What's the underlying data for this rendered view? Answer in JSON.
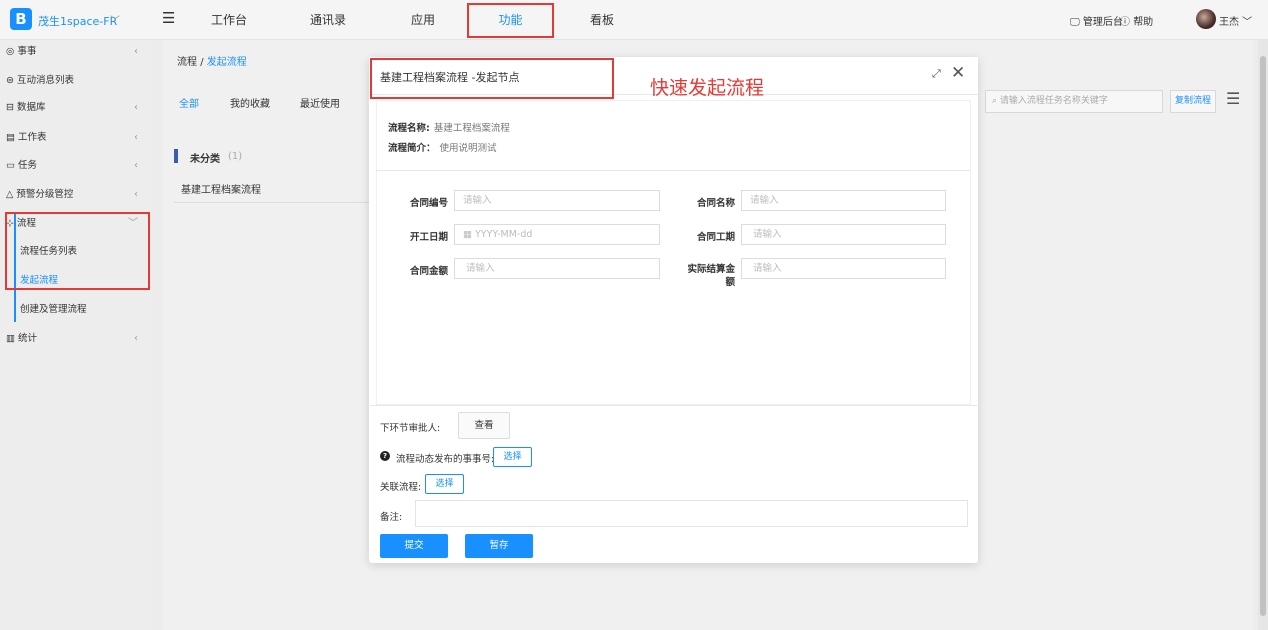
{
  "topbar": {
    "logo_letter": "B",
    "org_name": "茂生1space-FR",
    "nav": [
      "工作台",
      "通讯录",
      "应用",
      "功能",
      "看板"
    ],
    "admin": "管理后台",
    "help": "帮助",
    "user": "王杰"
  },
  "sidebar": {
    "items": [
      {
        "label": "事事"
      },
      {
        "label": "互动消息列表"
      },
      {
        "label": "数据库"
      },
      {
        "label": "工作表"
      },
      {
        "label": "任务"
      },
      {
        "label": "预警分级管控"
      },
      {
        "label": "流程"
      },
      {
        "label": "流程任务列表"
      },
      {
        "label": "发起流程"
      },
      {
        "label": "创建及管理流程"
      },
      {
        "label": "统计"
      }
    ]
  },
  "main": {
    "breadcrumb": {
      "root": "流程",
      "sep": "/",
      "current": "发起流程"
    },
    "tabs": [
      "全部",
      "我的收藏",
      "最近使用"
    ],
    "search_placeholder": "请输入流程任务名称关键字",
    "copy_button": "复制流程",
    "category": {
      "name": "未分类",
      "count": "(1)"
    },
    "list": [
      "基建工程档案流程"
    ]
  },
  "modal": {
    "title": "基建工程档案流程 -发起节点",
    "annotation": "快速发起流程",
    "info": {
      "name_key": "流程名称:",
      "name_value": "基建工程档案流程",
      "desc_key": "流程简介：",
      "desc_value": "使用说明测试"
    },
    "fields": [
      {
        "label": "合同编号",
        "placeholder": "请输入"
      },
      {
        "label": "合同名称",
        "placeholder": "请输入"
      },
      {
        "label": "开工日期",
        "placeholder": "YYYY-MM-dd"
      },
      {
        "label": "合同工期",
        "placeholder": "请输入"
      },
      {
        "label": "合同金额",
        "placeholder": "请输入"
      },
      {
        "label_line1": "实际结算金",
        "label_line2": "额",
        "placeholder": "请输入"
      }
    ],
    "next_approver_label": "下环节审批人:",
    "view_button": "查看",
    "dynamic_label": "流程动态发布的事事号:",
    "select_button": "选择",
    "related_label": "关联流程:",
    "note_label": "备注:",
    "submit_button": "提交",
    "save_button": "暂存"
  }
}
